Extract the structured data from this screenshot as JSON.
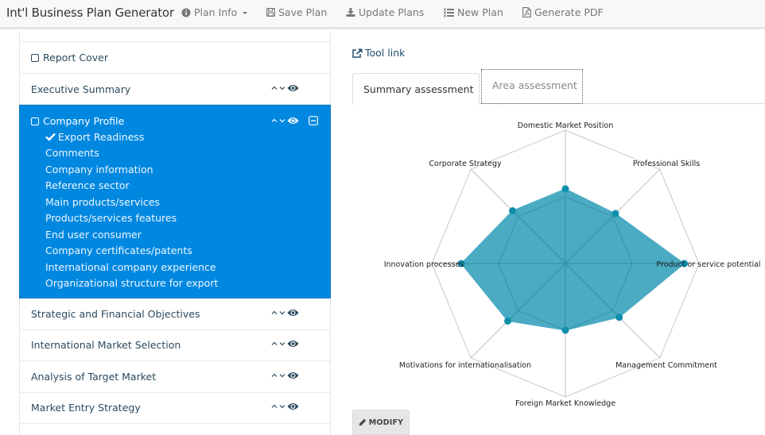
{
  "navbar": {
    "brand": "Int'l Business Plan Generator",
    "items": [
      {
        "label": "Plan Info",
        "icon": "info-circle-icon",
        "dropdown": true
      },
      {
        "label": "Save Plan",
        "icon": "floppy-disk-icon"
      },
      {
        "label": "Update Plans",
        "icon": "download-icon"
      },
      {
        "label": "New Plan",
        "icon": "list-ol-icon"
      },
      {
        "label": "Generate PDF",
        "icon": "file-pdf-icon"
      }
    ]
  },
  "sections": {
    "report_cover": "Report Cover",
    "executive_summary": "Executive Summary",
    "company_profile": {
      "title": "Company Profile",
      "items": [
        {
          "label": "Export Readiness",
          "checked": true
        },
        {
          "label": "Comments"
        },
        {
          "label": "Company information"
        },
        {
          "label": "Reference sector"
        },
        {
          "label": "Main products/services"
        },
        {
          "label": "Products/services features"
        },
        {
          "label": "End user consumer"
        },
        {
          "label": "Company certificates/patents"
        },
        {
          "label": "International company experience"
        },
        {
          "label": "Organizational structure for export"
        }
      ]
    },
    "others": [
      "Strategic and Financial Objectives",
      "International Market Selection",
      "Analysis of Target Market",
      "Market Entry Strategy"
    ]
  },
  "right": {
    "tool_link": "Tool link",
    "tabs": [
      "Summary assessment",
      "Area assessment"
    ],
    "active_tab": "Summary assessment",
    "modify_label": "MODIFY"
  },
  "colors": {
    "active_row": "#0088e0",
    "radar_fill": "#4aabc3",
    "radar_point": "#0e8fac",
    "grid": "#c8c8c8"
  },
  "chart_data": {
    "type": "radar",
    "title": "",
    "categories": [
      "Domestic Market Position",
      "Professional Skills",
      "Product or service potential",
      "Management Commitment",
      "Foreign Market Knowledge",
      "Motivations for internationalisation",
      "Innovation processes",
      "Corporate Strategy"
    ],
    "series": [
      {
        "name": "Summary assessment",
        "values": [
          5.6,
          5.3,
          8.9,
          5.7,
          5.0,
          6.1,
          7.8,
          5.6
        ]
      }
    ],
    "rlim": [
      0,
      10
    ],
    "rings": [
      5,
      10
    ],
    "grid": true,
    "legend": "none"
  }
}
